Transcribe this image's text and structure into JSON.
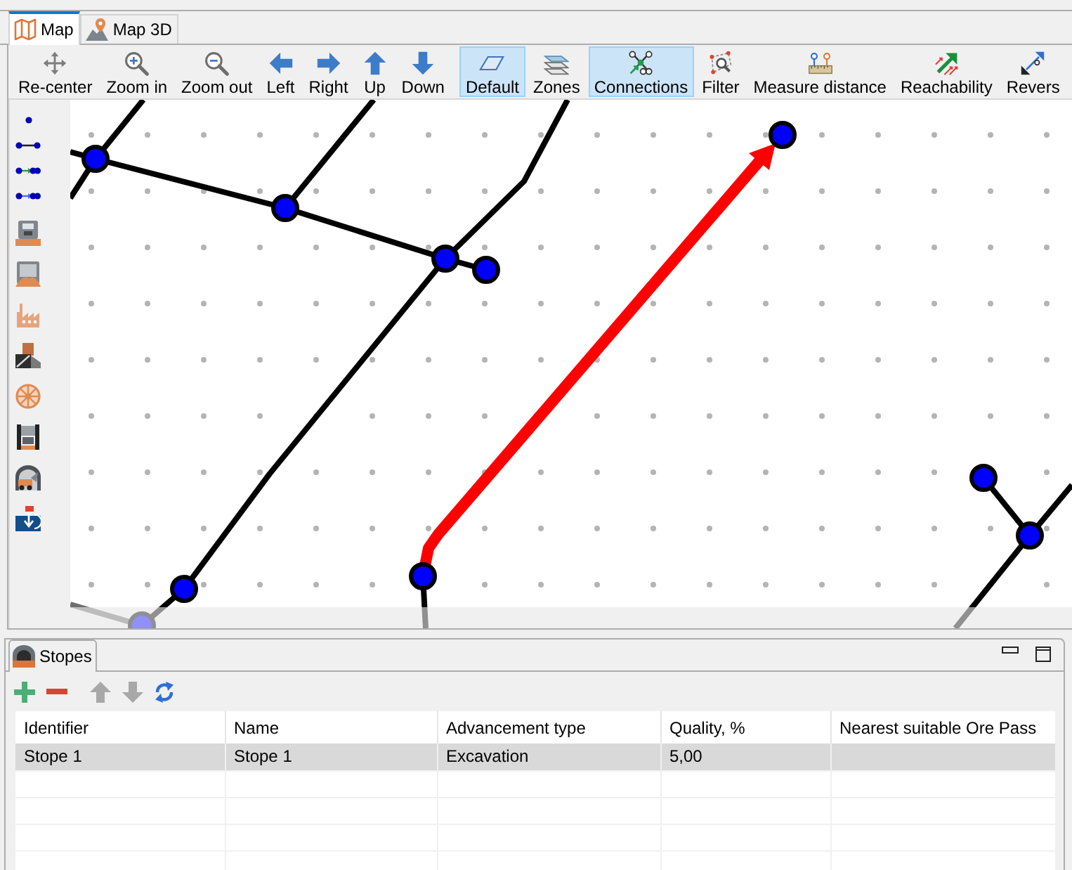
{
  "tabs": [
    {
      "label": "Map",
      "selected": true
    },
    {
      "label": "Map 3D",
      "selected": false
    }
  ],
  "toolbar": [
    {
      "label": "Re-center",
      "selected": false
    },
    {
      "label": "Zoom in",
      "selected": false
    },
    {
      "label": "Zoom out",
      "selected": false
    },
    {
      "label": "Left",
      "selected": false
    },
    {
      "label": "Right",
      "selected": false
    },
    {
      "label": "Up",
      "selected": false
    },
    {
      "label": "Down",
      "selected": false
    },
    {
      "label": "Default",
      "selected": true
    },
    {
      "label": "Zones",
      "selected": false
    },
    {
      "label": "Connections",
      "selected": true
    },
    {
      "label": "Filter",
      "selected": false
    },
    {
      "label": "Measure distance",
      "selected": false
    },
    {
      "label": "Reachability",
      "selected": false
    },
    {
      "label": "Revers",
      "selected": false
    }
  ],
  "stopes_panel": {
    "tab": "Stopes",
    "toolbar": [
      {
        "kind": "add",
        "disabled": false
      },
      {
        "kind": "remove",
        "disabled": false
      },
      {
        "kind": "move_up",
        "disabled": true
      },
      {
        "kind": "move_down",
        "disabled": true
      },
      {
        "kind": "refresh",
        "disabled": false
      }
    ],
    "table": {
      "columns": [
        "Identifier",
        "Name",
        "Advancement type",
        "Quality, %",
        "Nearest suitable Ore Pass"
      ],
      "rows": [
        {
          "cells": [
            "Stope 1",
            "Stope 1",
            "Excavation",
            "5,00"
          ],
          "selected": true
        }
      ]
    }
  }
}
